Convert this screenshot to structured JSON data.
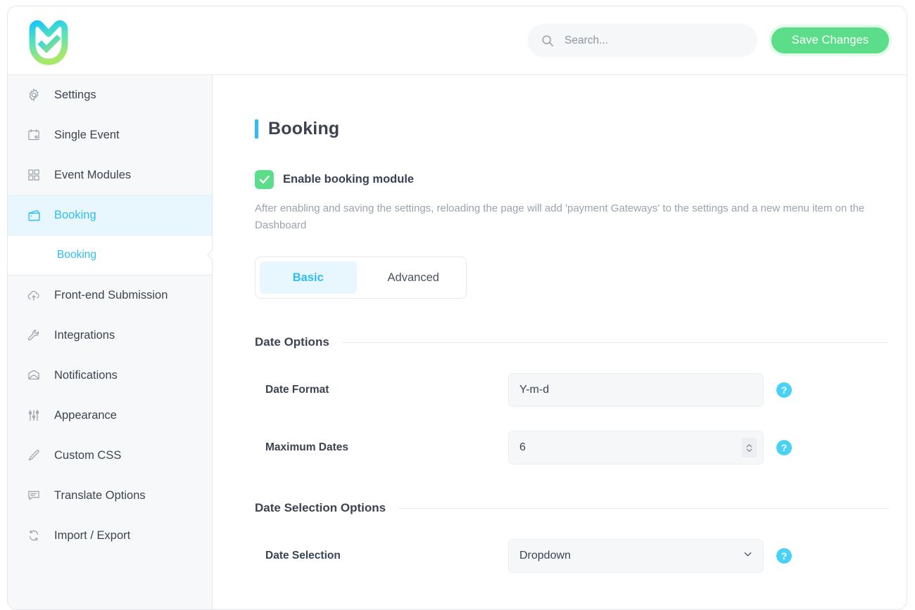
{
  "header": {
    "logo_alt": "shield-check-logo",
    "search": {
      "placeholder": "Search...",
      "value": ""
    },
    "save_label": "Save Changes"
  },
  "sidebar": {
    "items": [
      {
        "label": "Settings",
        "icon": "gear-icon",
        "active": false
      },
      {
        "label": "Single Event",
        "icon": "calendar-icon",
        "active": false
      },
      {
        "label": "Event Modules",
        "icon": "grid-icon",
        "active": false
      },
      {
        "label": "Booking",
        "icon": "wallet-icon",
        "active": true
      },
      {
        "label": "Front-end Submission",
        "icon": "cloud-upload-icon",
        "active": false
      },
      {
        "label": "Integrations",
        "icon": "wrench-icon",
        "active": false
      },
      {
        "label": "Notifications",
        "icon": "envelope-icon",
        "active": false
      },
      {
        "label": "Appearance",
        "icon": "sliders-icon",
        "active": false
      },
      {
        "label": "Custom CSS",
        "icon": "pencil-icon",
        "active": false
      },
      {
        "label": "Translate Options",
        "icon": "chat-icon",
        "active": false
      },
      {
        "label": "Import / Export",
        "icon": "refresh-icon",
        "active": false
      }
    ],
    "sub_item": {
      "label": "Booking",
      "active": true
    }
  },
  "main": {
    "page_title": "Booking",
    "enable_checkbox": {
      "label": "Enable booking module",
      "checked": true,
      "description": "After enabling and saving the settings, reloading the page will add 'payment Gateways' to the settings and a new menu item on the Dashboard"
    },
    "tabs": [
      {
        "label": "Basic",
        "active": true
      },
      {
        "label": "Advanced",
        "active": false
      }
    ],
    "sections": [
      {
        "title": "Date Options",
        "fields": [
          {
            "label": "Date Format",
            "type": "text",
            "value": "Y-m-d",
            "help": "?"
          },
          {
            "label": "Maximum Dates",
            "type": "number",
            "value": "6",
            "help": "?"
          }
        ]
      },
      {
        "title": "Date Selection Options",
        "fields": [
          {
            "label": "Date Selection",
            "type": "select",
            "value": "Dropdown",
            "help": "?"
          }
        ]
      }
    ]
  },
  "colors": {
    "accent_cyan": "#2fbdf1",
    "accent_green": "#5bdd8a",
    "help_blue": "#4ad2f5",
    "sidebar_bg": "#f7f8fa",
    "active_bg": "#e8f7fd",
    "text_dark": "#3b4352",
    "text_muted": "#9ba3ad"
  }
}
